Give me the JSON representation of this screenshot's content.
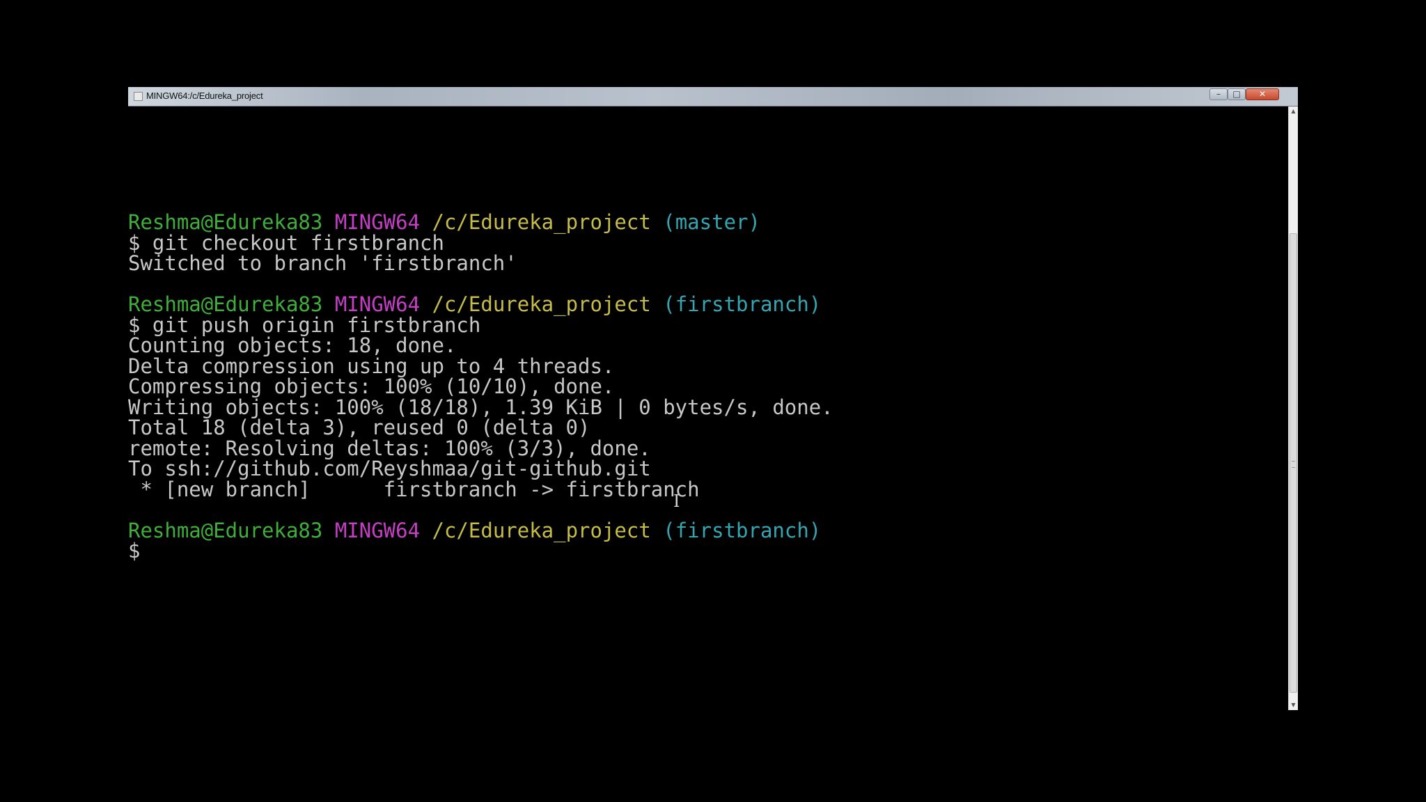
{
  "window": {
    "title": "MINGW64:/c/Edureka_project",
    "icon": "terminal-app-icon",
    "controls": {
      "minimize_icon": "minimize-icon",
      "maximize_icon": "maximize-icon",
      "close_icon": "close-icon",
      "minimize_glyph": "–",
      "maximize_glyph": "□",
      "close_glyph": "✕"
    }
  },
  "colors": {
    "user_host": "#3fae3a",
    "system": "#c43fc4",
    "path": "#c6bd49",
    "branch": "#34a6b2",
    "output": "#c8c8c8",
    "background": "#000000"
  },
  "terminal": {
    "prompt1": {
      "user_host": "Reshma@Edureka83",
      "system": "MINGW64",
      "path": "/c/Edureka_project",
      "branch": "(master)"
    },
    "command1": "$ git checkout firstbranch",
    "output1": [
      "Switched to branch 'firstbranch'"
    ],
    "prompt2": {
      "user_host": "Reshma@Edureka83",
      "system": "MINGW64",
      "path": "/c/Edureka_project",
      "branch": "(firstbranch)"
    },
    "command2": "$ git push origin firstbranch",
    "output2": [
      "Counting objects: 18, done.",
      "Delta compression using up to 4 threads.",
      "Compressing objects: 100% (10/10), done.",
      "Writing objects: 100% (18/18), 1.39 KiB | 0 bytes/s, done.",
      "Total 18 (delta 3), reused 0 (delta 0)",
      "remote: Resolving deltas: 100% (3/3), done.",
      "To ssh://github.com/Reyshmaa/git-github.git",
      " * [new branch]      firstbranch -> firstbranch"
    ],
    "prompt3": {
      "user_host": "Reshma@Edureka83",
      "system": "MINGW64",
      "path": "/c/Edureka_project",
      "branch": "(firstbranch)"
    },
    "command3": "$"
  },
  "scrollbar": {
    "up_glyph": "▲",
    "down_glyph": "▼"
  },
  "mouse_cursor": {
    "icon": "text-ibeam-cursor-icon",
    "glyph": "I"
  }
}
